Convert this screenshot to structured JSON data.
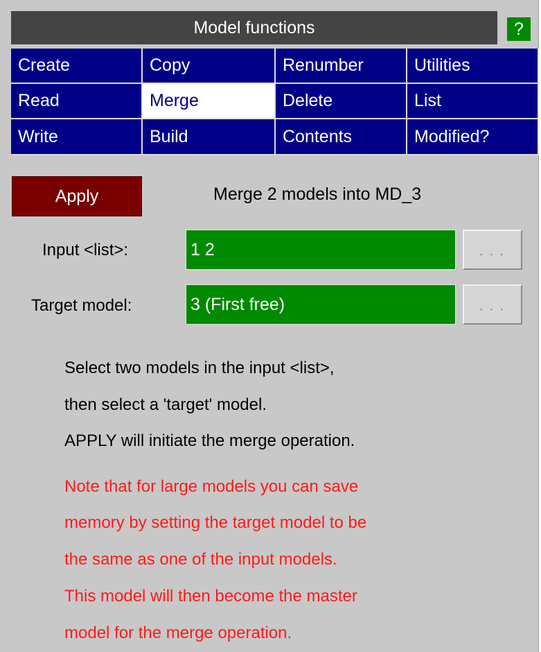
{
  "header": {
    "title": "Model functions",
    "help_label": "?"
  },
  "menu": [
    [
      "Create",
      "Copy",
      "Renumber",
      "Utilities"
    ],
    [
      "Read",
      "Merge",
      "Delete",
      "List"
    ],
    [
      "Write",
      "Build",
      "Contents",
      "Modified?"
    ]
  ],
  "active_menu_item": "Merge",
  "apply": {
    "label": "Apply",
    "description": "Merge 2 models into MD_3"
  },
  "input_list": {
    "label": "Input <list>:",
    "value": "1 2",
    "browse_label": ". . ."
  },
  "target_model": {
    "label": "Target model:",
    "value": "3 (First free)",
    "browse_label": ". . ."
  },
  "help_text": [
    "Select two models in the input <list>,",
    "then select a 'target' model.",
    "APPLY will initiate the merge operation."
  ],
  "note_text": [
    "Note that for large models you can save",
    "memory by setting the target model to be",
    "the same as one of the input models.",
    "This model will then become the master",
    "model for the merge operation."
  ],
  "colors": {
    "panel": "#c8c8c8",
    "title_bar": "#444444",
    "menu_button": "#000087",
    "active_button": "#ffffff",
    "apply_button": "#7a0000",
    "field": "#008a00",
    "help_button": "#008a00",
    "note_text": "#ff1a1a"
  }
}
